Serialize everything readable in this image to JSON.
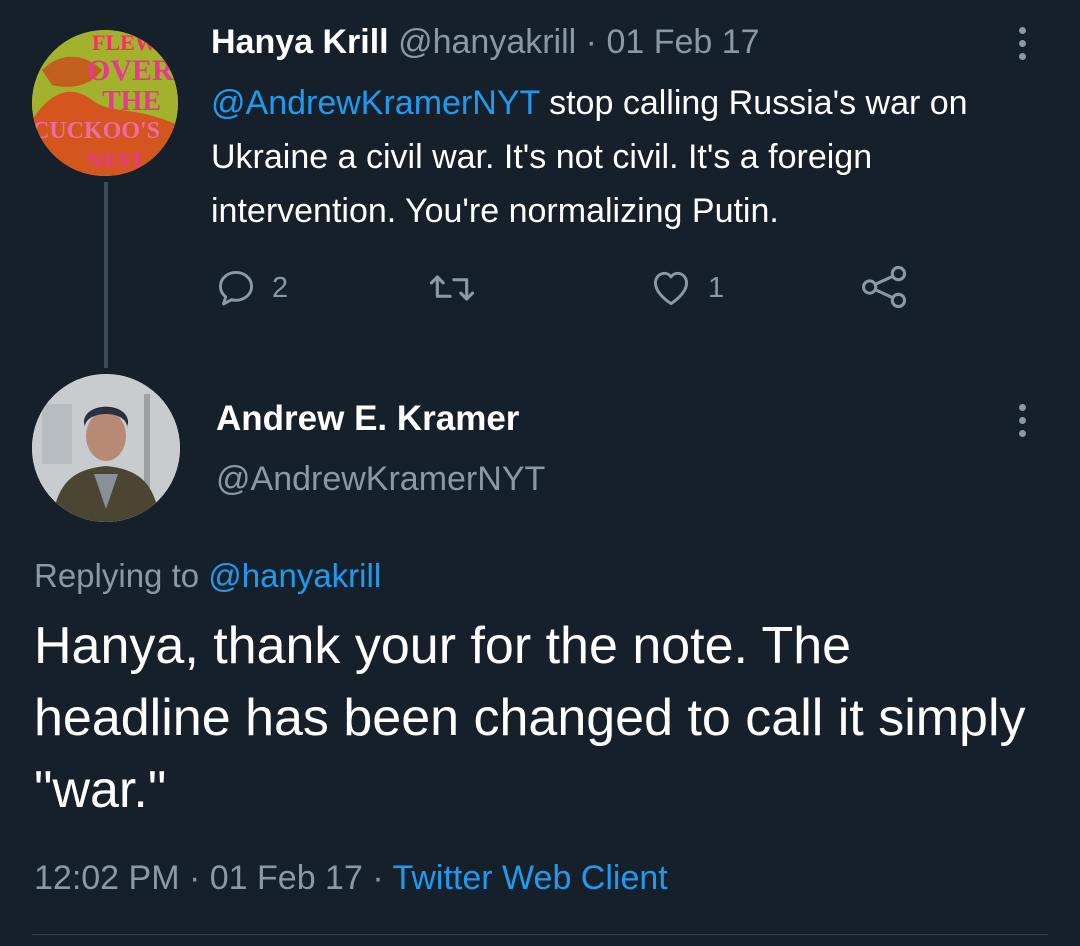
{
  "tweet1": {
    "display_name": "Hanya Krill",
    "handle": "@hanyakrill",
    "separator": "·",
    "date": "01 Feb 17",
    "mention": "@AndrewKramerNYT",
    "text": " stop calling Russia's war on Ukraine a civil war. It's not civil. It's a foreign intervention. You're normalizing Putin.",
    "avatar_text": [
      "FLEW",
      "OVER",
      "THE",
      "CUCKOO'S",
      "NEST"
    ],
    "actions": {
      "reply_count": "2",
      "retweet_count": "",
      "like_count": "1"
    },
    "icons": [
      "more-vert-icon",
      "reply-icon",
      "retweet-icon",
      "like-icon",
      "share-icon"
    ]
  },
  "tweet2": {
    "display_name": "Andrew E. Kramer",
    "handle": "@AndrewKramerNYT",
    "replying_prefix": "Replying to ",
    "replying_to": "@hanyakrill",
    "text": "Hanya, thank your for the note. The headline has been changed to call it simply \"war.\"",
    "time": "12:02 PM",
    "separator": " · ",
    "date": "01 Feb 17",
    "source": "Twitter Web Client"
  },
  "colors": {
    "background": "#15202b",
    "text": "#ffffff",
    "secondary": "#8b98a5",
    "accent": "#1d9bf0",
    "thread_line": "#3c4b5a"
  }
}
